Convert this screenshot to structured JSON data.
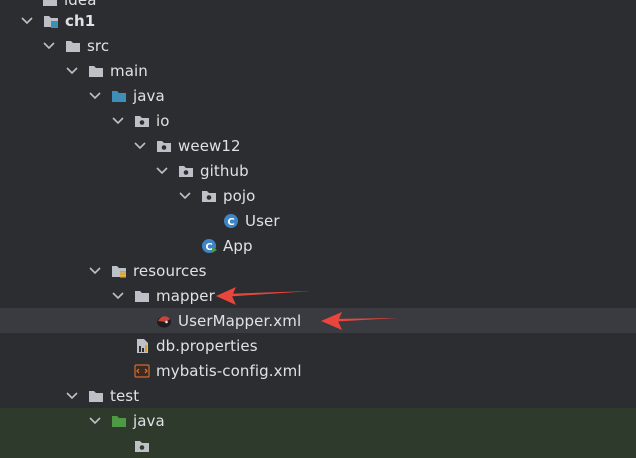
{
  "tree": {
    "items": [
      {
        "label": "idea",
        "icon": "folder-icon"
      },
      {
        "label": "ch1",
        "icon": "module-icon"
      },
      {
        "label": "src",
        "icon": "folder-icon"
      },
      {
        "label": "main",
        "icon": "folder-icon"
      },
      {
        "label": "java",
        "icon": "source-folder-icon"
      },
      {
        "label": "io",
        "icon": "package-icon"
      },
      {
        "label": "weew12",
        "icon": "package-icon"
      },
      {
        "label": "github",
        "icon": "package-icon"
      },
      {
        "label": "pojo",
        "icon": "package-icon"
      },
      {
        "label": "User",
        "icon": "java-class-icon"
      },
      {
        "label": "App",
        "icon": "java-main-class-icon"
      },
      {
        "label": "resources",
        "icon": "resources-folder-icon"
      },
      {
        "label": "mapper",
        "icon": "folder-icon"
      },
      {
        "label": "UserMapper.xml",
        "icon": "mybatis-xml-icon"
      },
      {
        "label": "db.properties",
        "icon": "properties-file-icon"
      },
      {
        "label": "mybatis-config.xml",
        "icon": "xml-file-icon"
      },
      {
        "label": "test",
        "icon": "folder-icon"
      },
      {
        "label": "java",
        "icon": "test-source-folder-icon"
      },
      {
        "label": "",
        "icon": "package-icon"
      }
    ]
  },
  "colors": {
    "background": "#2b2d30",
    "selected_row": "#393b40",
    "test_row": "#2e3b2c",
    "text": "#dfe1e5",
    "folder": "#bdc0c6",
    "source_folder": "#3d8fb8",
    "test_folder": "#4e9a44",
    "class_badge": "#3f84c4",
    "annotation_arrow": "#e8463c"
  }
}
